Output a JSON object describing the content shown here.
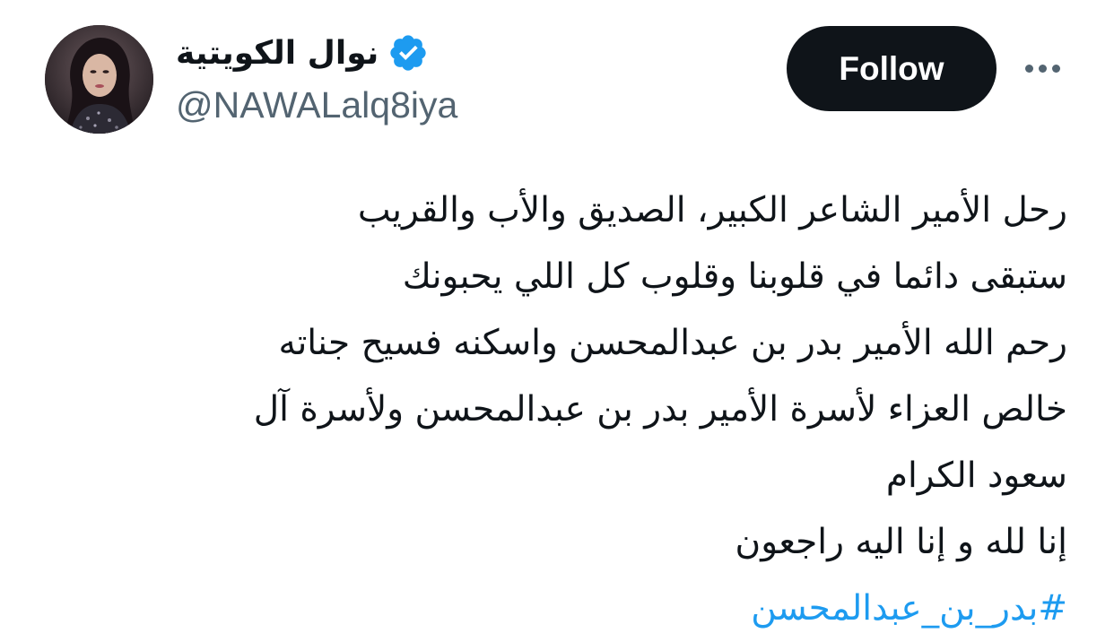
{
  "author": {
    "display_name": "نوال الكويتية",
    "handle": "@NAWALalq8iya",
    "verified": true,
    "verified_badge_icon": "verified-check-badge-icon",
    "avatar": "profile-photo"
  },
  "actions": {
    "follow_label": "Follow",
    "more_icon": "more-options-dots-icon"
  },
  "tweet": {
    "lines": [
      "رحل الأمير الشاعر الكبير، الصديق والأب والقريب",
      "ستبقى دائما في قلوبنا وقلوب كل اللي يحبونك",
      "رحم الله الأمير بدر بن عبدالمحسن واسكنه فسيح جناته",
      "خالص العزاء لأسرة الأمير بدر بن عبدالمحسن ولأسرة آل",
      "سعود الكرام",
      "إنا لله و إنا اليه راجعون"
    ],
    "hashtag": "#بدر_بن_عبدالمحسن"
  },
  "colors": {
    "text_primary": "#0f1419",
    "text_secondary": "#536471",
    "link": "#1d9bf0",
    "verified_badge": "#1d9bf0",
    "follow_button_bg": "#0f1419",
    "follow_button_text": "#ffffff"
  }
}
